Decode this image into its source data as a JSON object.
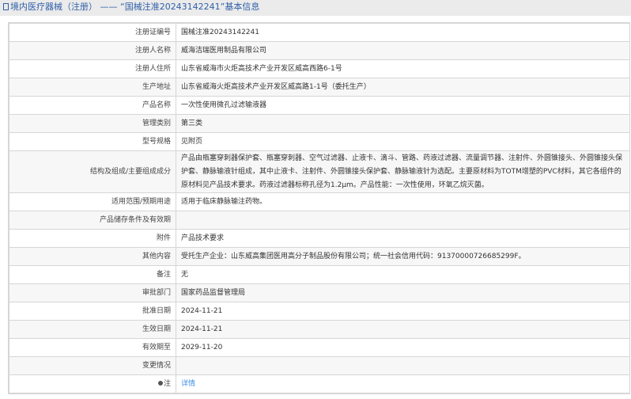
{
  "header": {
    "title": "境内医疗器械（注册） —— “国械注准20243142241”基本信息"
  },
  "rows": [
    {
      "label": "注册证编号",
      "value": "国械注准20243142241"
    },
    {
      "label": "注册人名称",
      "value": "威海洁瑞医用制品有限公司"
    },
    {
      "label": "注册人住所",
      "value": "山东省威海市火炬高技术产业开发区威高西路6-1号"
    },
    {
      "label": "生产地址",
      "value": "山东省威海火炬高技术产业开发区威高路1-1号（委托生产）"
    },
    {
      "label": "产品名称",
      "value": "一次性使用微孔过滤输液器"
    },
    {
      "label": "管理类别",
      "value": "第三类"
    },
    {
      "label": "型号规格",
      "value": "见附页"
    },
    {
      "label": "结构及组成/主要组成成分",
      "value": "产品由瓶塞穿刺器保护套、瓶塞穿刺器、空气过滤器、止液卡、滴斗、管路、药液过滤器、流量调节器、注射件、外圆锥接头、外圆锥接头保护套、静脉输液针组成，其中止液卡、注射件、外圆锥接头保护套、静脉输液针为选配。主要原材料为TOTM增塑的PVC材料，其它各组件的原材料见产品技术要求。药液过滤器标称孔径为1.2μm。产品性能：一次性使用，环氧乙烷灭菌。"
    },
    {
      "label": "适用范围/预期用途",
      "value": "适用于临床静脉输注药物。"
    },
    {
      "label": "产品储存条件及有效期",
      "value": ""
    },
    {
      "label": "附件",
      "value": "产品技术要求"
    },
    {
      "label": "其他内容",
      "value": "受托生产企业：山东威高集团医用高分子制品股份有限公司；统一社会信用代码：91370000726685299F。"
    },
    {
      "label": "备注",
      "value": "无"
    },
    {
      "label": "审批部门",
      "value": "国家药品监督管理局"
    },
    {
      "label": "批准日期",
      "value": "2024-11-21"
    },
    {
      "label": "生效日期",
      "value": "2024-11-21"
    },
    {
      "label": "有效期至",
      "value": "2029-11-20"
    },
    {
      "label": "变更情况",
      "value": ""
    }
  ],
  "note_row": {
    "label": "注",
    "link": "详情"
  },
  "colors": {
    "title": "#2f5fa8",
    "link": "#3a8ee6",
    "border": "#d6d6d6"
  }
}
